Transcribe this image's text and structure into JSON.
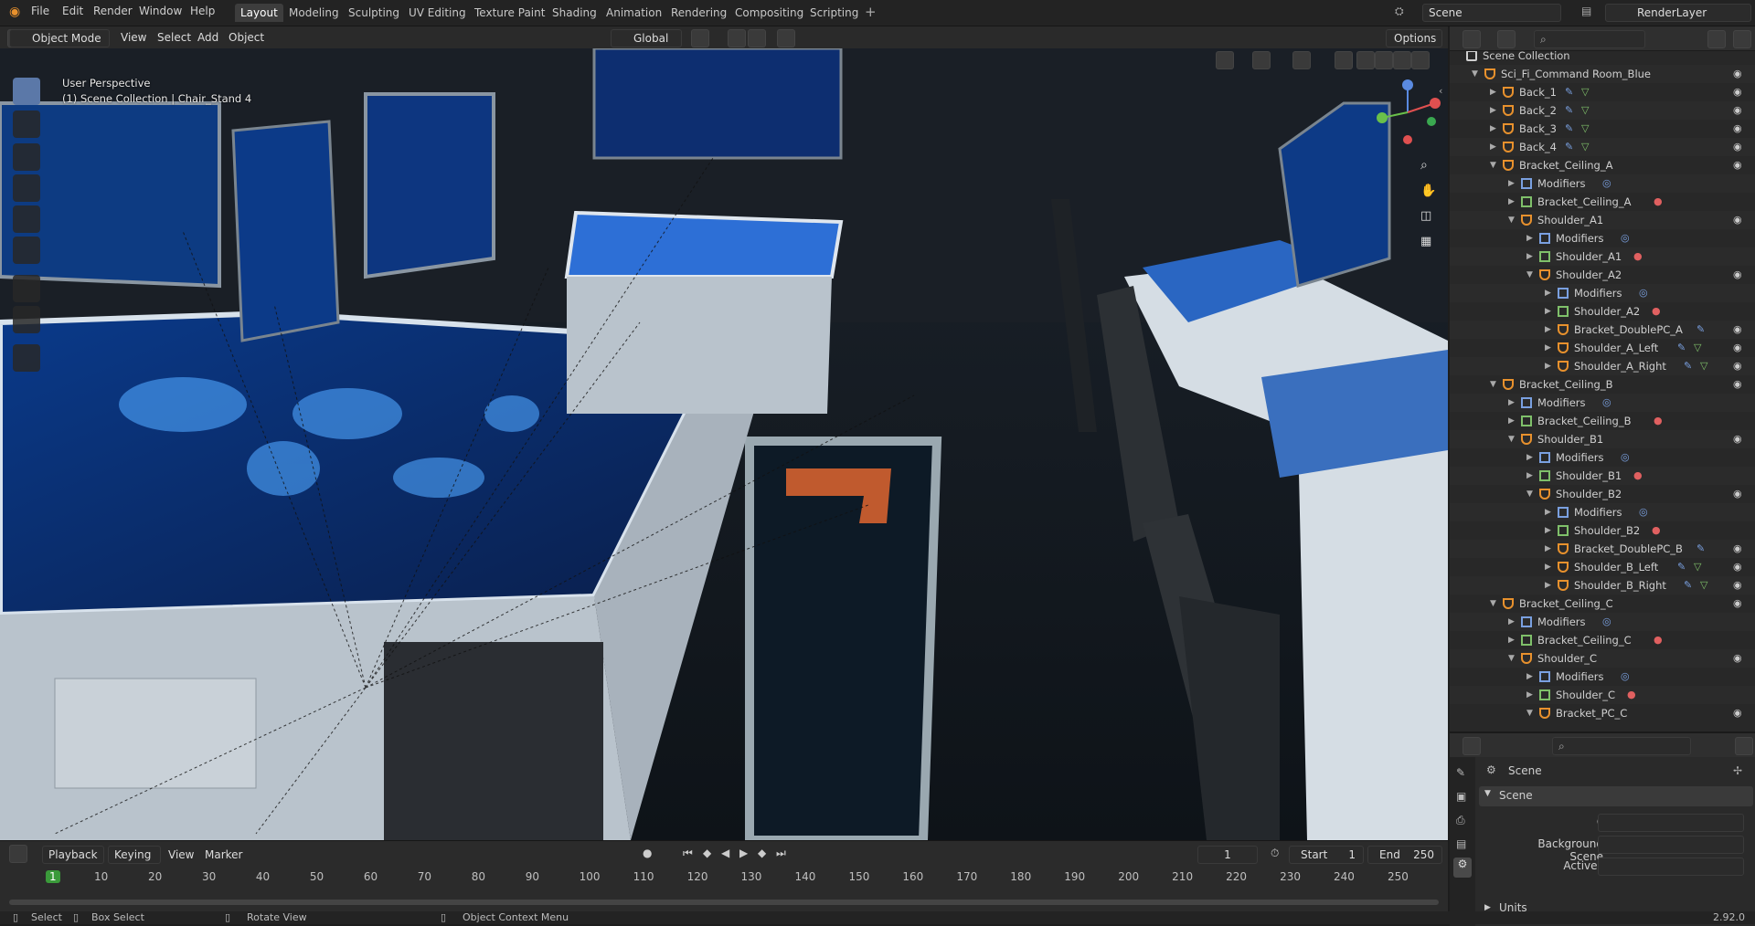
{
  "menu": [
    "File",
    "Edit",
    "Render",
    "Window",
    "Help"
  ],
  "workspaces": [
    "Layout",
    "Modeling",
    "Sculpting",
    "UV Editing",
    "Texture Paint",
    "Shading",
    "Animation",
    "Rendering",
    "Compositing",
    "Scripting"
  ],
  "active_workspace": "Layout",
  "scene_name": "Scene",
  "render_layer": "RenderLayer",
  "viewport": {
    "mode": "Object Mode",
    "menus": [
      "View",
      "Select",
      "Add",
      "Object"
    ],
    "orientation": "Global",
    "options_label": "Options",
    "view_title": "User Perspective",
    "view_sub": "(1) Scene Collection | Chair_Stand 4"
  },
  "outliner": {
    "rows": [
      {
        "label": "Scene Collection",
        "indent": 0,
        "arrow": "",
        "icon": "collection",
        "eye": false,
        "type": "scene"
      },
      {
        "label": "Sci_Fi_Command Room_Blue",
        "indent": 1,
        "arrow": "▼",
        "icon": "armature",
        "eye": true
      },
      {
        "label": "Back_1",
        "indent": 2,
        "arrow": "▶",
        "icon": "empty",
        "eye": true,
        "wrench": true,
        "mesh": true
      },
      {
        "label": "Back_2",
        "indent": 2,
        "arrow": "▶",
        "icon": "empty",
        "eye": true,
        "wrench": true,
        "mesh": true
      },
      {
        "label": "Back_3",
        "indent": 2,
        "arrow": "▶",
        "icon": "empty",
        "eye": true,
        "wrench": true,
        "mesh": true
      },
      {
        "label": "Back_4",
        "indent": 2,
        "arrow": "▶",
        "icon": "empty",
        "eye": true,
        "wrench": true,
        "mesh": true
      },
      {
        "label": "Bracket_Ceiling_A",
        "indent": 2,
        "arrow": "▼",
        "icon": "empty",
        "eye": true
      },
      {
        "label": "Modifiers",
        "indent": 3,
        "arrow": "▶",
        "icon": "wrench",
        "eye": false,
        "modifier": true
      },
      {
        "label": "Bracket_Ceiling_A",
        "indent": 3,
        "arrow": "▶",
        "icon": "mesh",
        "eye": false,
        "material": true
      },
      {
        "label": "Shoulder_A1",
        "indent": 3,
        "arrow": "▼",
        "icon": "empty",
        "eye": true
      },
      {
        "label": "Modifiers",
        "indent": 4,
        "arrow": "▶",
        "icon": "wrench",
        "eye": false,
        "modifier": true
      },
      {
        "label": "Shoulder_A1",
        "indent": 4,
        "arrow": "▶",
        "icon": "mesh",
        "eye": false,
        "material": true
      },
      {
        "label": "Shoulder_A2",
        "indent": 4,
        "arrow": "▼",
        "icon": "empty",
        "eye": true
      },
      {
        "label": "Modifiers",
        "indent": 5,
        "arrow": "▶",
        "icon": "wrench",
        "eye": false,
        "modifier": true
      },
      {
        "label": "Shoulder_A2",
        "indent": 5,
        "arrow": "▶",
        "icon": "mesh",
        "eye": false,
        "material": true
      },
      {
        "label": "Bracket_DoublePC_A",
        "indent": 5,
        "arrow": "▶",
        "icon": "empty",
        "eye": true,
        "wrench": true
      },
      {
        "label": "Shoulder_A_Left",
        "indent": 5,
        "arrow": "▶",
        "icon": "empty",
        "eye": true,
        "wrench": true,
        "mesh": true
      },
      {
        "label": "Shoulder_A_Right",
        "indent": 5,
        "arrow": "▶",
        "icon": "empty",
        "eye": true,
        "wrench": true,
        "mesh": true
      },
      {
        "label": "Bracket_Ceiling_B",
        "indent": 2,
        "arrow": "▼",
        "icon": "empty",
        "eye": true
      },
      {
        "label": "Modifiers",
        "indent": 3,
        "arrow": "▶",
        "icon": "wrench",
        "eye": false,
        "modifier": true
      },
      {
        "label": "Bracket_Ceiling_B",
        "indent": 3,
        "arrow": "▶",
        "icon": "mesh",
        "eye": false,
        "material": true
      },
      {
        "label": "Shoulder_B1",
        "indent": 3,
        "arrow": "▼",
        "icon": "empty",
        "eye": true
      },
      {
        "label": "Modifiers",
        "indent": 4,
        "arrow": "▶",
        "icon": "wrench",
        "eye": false,
        "modifier": true
      },
      {
        "label": "Shoulder_B1",
        "indent": 4,
        "arrow": "▶",
        "icon": "mesh",
        "eye": false,
        "material": true
      },
      {
        "label": "Shoulder_B2",
        "indent": 4,
        "arrow": "▼",
        "icon": "empty",
        "eye": true
      },
      {
        "label": "Modifiers",
        "indent": 5,
        "arrow": "▶",
        "icon": "wrench",
        "eye": false,
        "modifier": true
      },
      {
        "label": "Shoulder_B2",
        "indent": 5,
        "arrow": "▶",
        "icon": "mesh",
        "eye": false,
        "material": true
      },
      {
        "label": "Bracket_DoublePC_B",
        "indent": 5,
        "arrow": "▶",
        "icon": "empty",
        "eye": true,
        "wrench": true
      },
      {
        "label": "Shoulder_B_Left",
        "indent": 5,
        "arrow": "▶",
        "icon": "empty",
        "eye": true,
        "wrench": true,
        "mesh": true
      },
      {
        "label": "Shoulder_B_Right",
        "indent": 5,
        "arrow": "▶",
        "icon": "empty",
        "eye": true,
        "wrench": true,
        "mesh": true
      },
      {
        "label": "Bracket_Ceiling_C",
        "indent": 2,
        "arrow": "▼",
        "icon": "empty",
        "eye": true
      },
      {
        "label": "Modifiers",
        "indent": 3,
        "arrow": "▶",
        "icon": "wrench",
        "eye": false,
        "modifier": true
      },
      {
        "label": "Bracket_Ceiling_C",
        "indent": 3,
        "arrow": "▶",
        "icon": "mesh",
        "eye": false,
        "material": true
      },
      {
        "label": "Shoulder_C",
        "indent": 3,
        "arrow": "▼",
        "icon": "empty",
        "eye": true
      },
      {
        "label": "Modifiers",
        "indent": 4,
        "arrow": "▶",
        "icon": "wrench",
        "eye": false,
        "modifier": true
      },
      {
        "label": "Shoulder_C",
        "indent": 4,
        "arrow": "▶",
        "icon": "mesh",
        "eye": false,
        "material": true
      },
      {
        "label": "Bracket_PC_C",
        "indent": 4,
        "arrow": "▼",
        "icon": "empty",
        "eye": true
      }
    ]
  },
  "properties": {
    "header": "Scene",
    "panel": "Scene",
    "camera_label": "Camera",
    "background_label": "Background Scene",
    "clip_label": "Active Clip",
    "units_label": "Units"
  },
  "timeline": {
    "menus": [
      "Playback",
      "Keying",
      "View",
      "Marker"
    ],
    "current_frame": "1",
    "start_label": "Start",
    "start": "1",
    "end_label": "End",
    "end": "250",
    "ticks": [
      "1",
      "10",
      "20",
      "30",
      "40",
      "50",
      "60",
      "70",
      "80",
      "90",
      "100",
      "110",
      "120",
      "130",
      "140",
      "150",
      "160",
      "170",
      "180",
      "190",
      "200",
      "210",
      "220",
      "230",
      "240",
      "250"
    ]
  },
  "status": {
    "select": "Select",
    "box_select": "Box Select",
    "rotate": "Rotate View",
    "context": "Object Context Menu",
    "version": "2.92.0"
  },
  "colors": {
    "accent": "#5b78a8",
    "frame_marker": "#3a9a3a",
    "orange": "#e8912d"
  }
}
